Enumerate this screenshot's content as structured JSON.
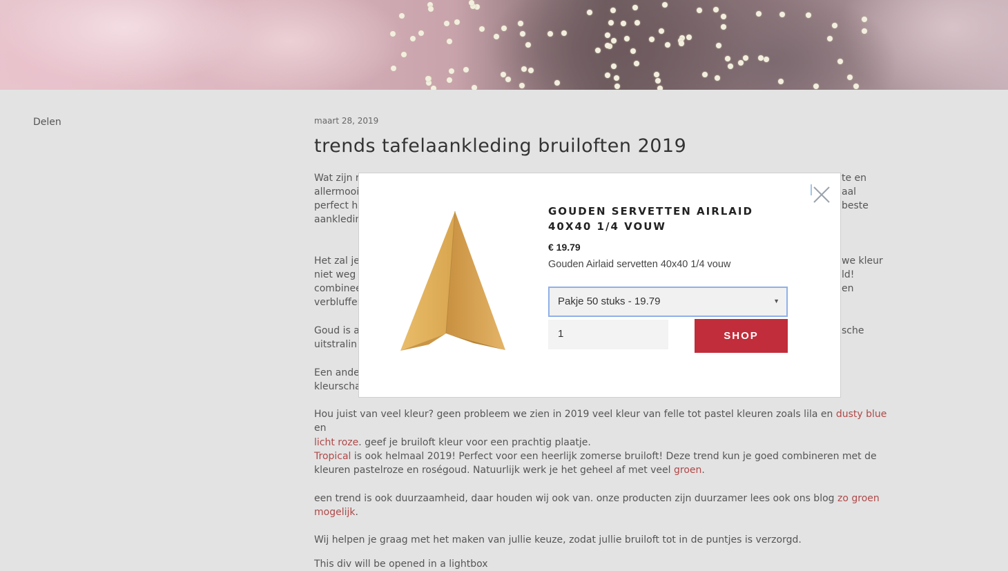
{
  "sidebar": {
    "share_label": "Delen"
  },
  "article": {
    "date": "maart 28, 2019",
    "title": "trends tafelaankleding bruiloften 2019",
    "para1_fragments": [
      "Wat zijn r",
      "allermooi",
      "perfect ho",
      "aankledin"
    ],
    "para1_right": [
      "te en",
      "aal",
      "beste"
    ],
    "para2_fragments": [
      "Het zal je",
      "niet weg t",
      "combinee",
      "verbluffer"
    ],
    "para2_right": [
      "we kleur",
      "ld!",
      "en"
    ],
    "para3_fragments": [
      "Goud is a",
      "uitstralin"
    ],
    "para3_right": [
      "sche"
    ],
    "para4_fragments": [
      "Een ander",
      "kleurscha"
    ],
    "para5": {
      "t1": "Hou juist van veel kleur? geen probleem we zien in 2019 veel kleur van felle tot pastel kleuren zoals lila en ",
      "link1": "dusty blue",
      "t2": " en ",
      "link2": "licht roze",
      "t3": ". geef je bruiloft kleur voor een prachtig plaatje."
    },
    "para6": {
      "link1": "Tropical",
      "t1": " is ook helmaal 2019! Perfect voor een heerlijk zomerse bruiloft! Deze trend kun je goed combineren met de kleuren pastelroze en roségoud. Natuurlijk werk je het geheel af met veel ",
      "link2": "groen",
      "t2": "."
    },
    "para7": {
      "t1": "een trend is ook duurzaamheid, daar houden wij ook van. onze producten zijn duurzamer lees ook ons blog ",
      "link1": "zo groen mogelijk",
      "t2": "."
    },
    "para8": "Wij helpen je graag met het maken van jullie keuze, zodat jullie bruiloft tot in de puntjes is verzorgd.",
    "para9": "This div will be opened in a lightbox"
  },
  "modal": {
    "product_title": "GOUDEN SERVETTEN AIRLAID 40X40 1/4 VOUW",
    "price": "€ 19.79",
    "description": "Gouden Airlaid servetten 40x40 1/4 vouw",
    "variant_selected": "Pakje 50 stuks - 19.79",
    "quantity": "1",
    "shop_label": "SHOP",
    "image_icon": "gold-napkin-image",
    "close_icon": "close-icon"
  },
  "colors": {
    "background": "#e3e3e3",
    "link": "#b04848",
    "shop_button": "#c12d3a",
    "select_border": "#8fb0e8"
  }
}
